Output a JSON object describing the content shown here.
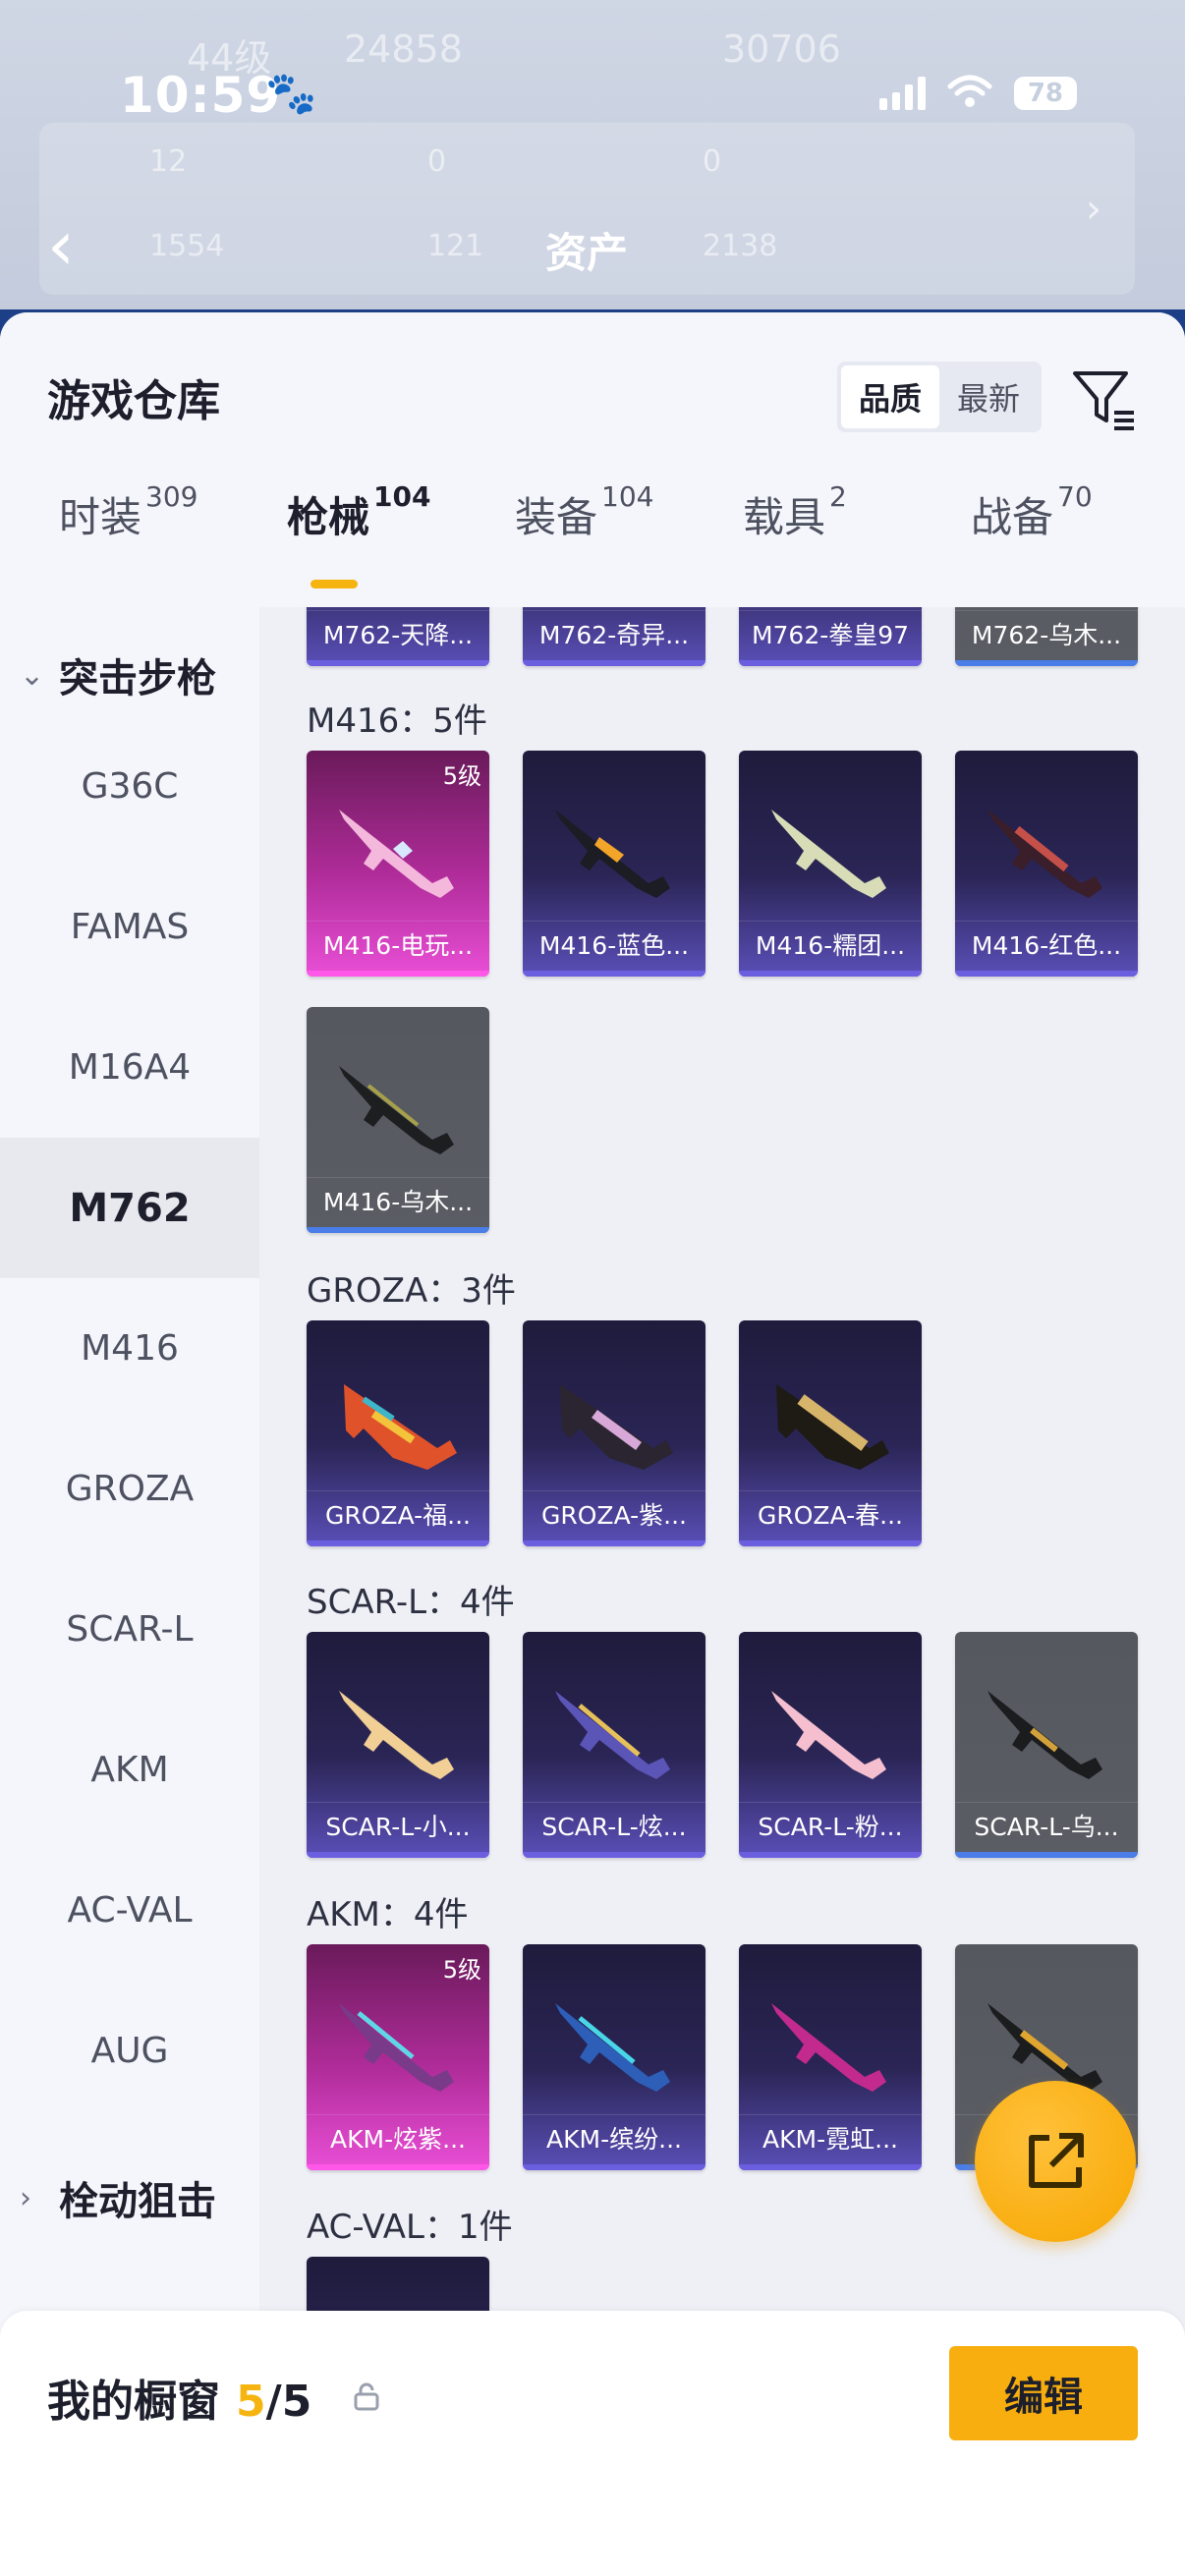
{
  "status": {
    "time": "10:59",
    "battery": "78"
  },
  "background": {
    "level_text": "44级",
    "views": "24858",
    "score": "30706",
    "stat1": "12",
    "stat2": "0",
    "stat3": "0",
    "stat4": "1554",
    "stat5": "121",
    "stat6": "2138",
    "title": "资产"
  },
  "sheet": {
    "title": "游戏仓库",
    "sort_quality": "品质",
    "sort_newest": "最新"
  },
  "tabs": [
    {
      "label": "时装",
      "count": "309"
    },
    {
      "label": "枪械",
      "count": "104"
    },
    {
      "label": "装备",
      "count": "104"
    },
    {
      "label": "载具",
      "count": "2"
    },
    {
      "label": "战备",
      "count": "70"
    }
  ],
  "sidebar": {
    "group1": "突击步枪",
    "items": [
      "G36C",
      "FAMAS",
      "M16A4",
      "M762",
      "M416",
      "GROZA",
      "SCAR-L",
      "AKM",
      "AC-VAL",
      "AUG"
    ],
    "group2": "栓动狙击"
  },
  "sections": {
    "m762_cards": [
      "M762-天降...",
      "M762-奇异...",
      "M762-拳皇97",
      "M762-乌木..."
    ],
    "m416_title": "M416：5件",
    "m416_cards": [
      "M416-电玩...",
      "M416-蓝色...",
      "M416-糯团...",
      "M416-红色...",
      "M416-乌木..."
    ],
    "m416_level": "5级",
    "groza_title": "GROZA：3件",
    "groza_cards": [
      "GROZA-福...",
      "GROZA-紫...",
      "GROZA-春..."
    ],
    "scar_title": "SCAR-L：4件",
    "scar_cards": [
      "SCAR-L-小...",
      "SCAR-L-炫...",
      "SCAR-L-粉...",
      "SCAR-L-乌..."
    ],
    "akm_title": "AKM：4件",
    "akm_cards": [
      "AKM-炫紫...",
      "AKM-缤纷...",
      "AKM-霓虹...",
      ""
    ],
    "akm_level": "5级",
    "acval_title": "AC-VAL：1件"
  },
  "bottom": {
    "label": "我的橱窗",
    "current": "5",
    "separator": "/5",
    "edit": "编辑"
  },
  "colors": {
    "accent": "#f5b40f",
    "purple_card": "#2a2555",
    "pink_card": "#b02c9a",
    "gray_card": "#5a5d64"
  }
}
